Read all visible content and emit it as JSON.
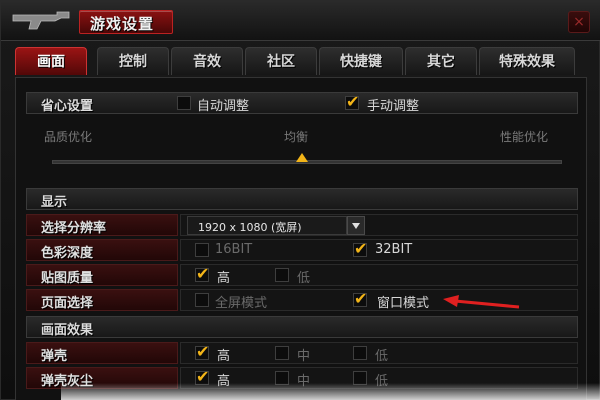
{
  "window": {
    "title": "游戏设置",
    "close_glyph": "×"
  },
  "tabs": [
    {
      "label": "画面",
      "active": true
    },
    {
      "label": "控制",
      "active": false
    },
    {
      "label": "音效",
      "active": false
    },
    {
      "label": "社区",
      "active": false
    },
    {
      "label": "快捷键",
      "active": false
    },
    {
      "label": "其它",
      "active": false
    },
    {
      "label": "特殊效果",
      "active": false
    }
  ],
  "worry_free": {
    "title": "省心设置",
    "options": [
      {
        "label": "自动调整",
        "checked": false
      },
      {
        "label": "手动调整",
        "checked": true
      }
    ],
    "slider": {
      "left": "品质优化",
      "center": "均衡",
      "right": "性能优化",
      "value": 0.5
    }
  },
  "display": {
    "title": "显示",
    "resolution": {
      "label": "选择分辨率",
      "value": "1920 x 1080 (宽屏)"
    },
    "color_depth": {
      "label": "色彩深度",
      "options": [
        {
          "label": "16BIT",
          "checked": false,
          "disabled": true
        },
        {
          "label": "32BIT",
          "checked": true,
          "disabled": false
        }
      ]
    },
    "texture_quality": {
      "label": "贴图质量",
      "options": [
        {
          "label": "高",
          "checked": true
        },
        {
          "label": "低",
          "checked": false
        }
      ]
    },
    "page_select": {
      "label": "页面选择",
      "options": [
        {
          "label": "全屏模式",
          "checked": false,
          "disabled": true
        },
        {
          "label": "窗口模式",
          "checked": true,
          "disabled": false
        }
      ]
    }
  },
  "effects": {
    "title": "画面效果",
    "shell": {
      "label": "弹壳",
      "options": [
        {
          "label": "高",
          "checked": true
        },
        {
          "label": "中",
          "checked": false
        },
        {
          "label": "低",
          "checked": false
        }
      ]
    },
    "shell_dust": {
      "label": "弹壳灰尘",
      "options": [
        {
          "label": "高",
          "checked": true
        },
        {
          "label": "中",
          "checked": false
        },
        {
          "label": "低",
          "checked": false
        }
      ]
    }
  },
  "colors": {
    "accent": "#f2b418",
    "tab_active": "#9a1414",
    "annotation_arrow": "#e02020"
  },
  "icons": {
    "title_icon": "gun-icon",
    "close": "close-icon",
    "check": "check-icon",
    "dropdown": "chevron-down-icon",
    "slider": "slider-thumb-icon",
    "annotation": "red-arrow-icon"
  }
}
